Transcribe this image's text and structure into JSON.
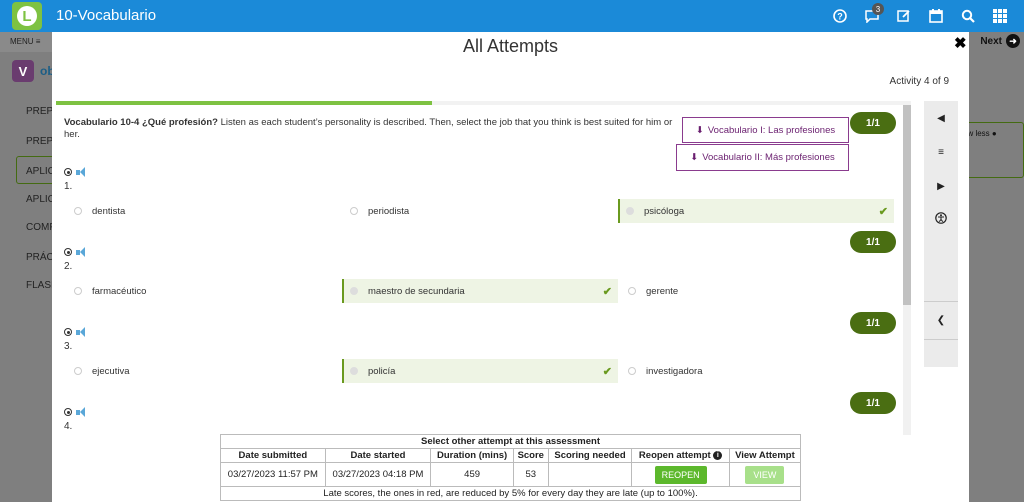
{
  "app": {
    "title": "10-Vocabulario",
    "logo_letter": "L",
    "notification_count": "3"
  },
  "top_icons": [
    "help-icon",
    "chat-icon",
    "edit-icon",
    "calendar-icon",
    "search-icon",
    "grid-icon"
  ],
  "background": {
    "menu_label": "MENU ≡",
    "logo_letter": "V",
    "logo_text": "ob",
    "nav_items": [
      "PREP",
      "PREP",
      "APLIC",
      "APLIC",
      "COMP",
      "PRÁC",
      "FLASI"
    ],
    "next_label": "Next",
    "show_less": "ow less"
  },
  "modal": {
    "title": "All Attempts",
    "activity_count": "Activity 4 of 9",
    "progress": 0.44,
    "close_label": "✖",
    "question_title": "Vocabulario 10-4 ¿Qué profesión?",
    "question_text": " Listen as each student’s personality is described. Then, select the job that you think is best suited for him or her.",
    "downloads": [
      "Vocabulario I: Las profesiones",
      "Vocabulario II: Más profesiones"
    ],
    "items": [
      {
        "num": "1.",
        "score": "1/1",
        "options": [
          "dentista",
          "periodista",
          "psicóloga"
        ],
        "selected": 2
      },
      {
        "num": "2.",
        "score": "1/1",
        "options": [
          "farmacéutico",
          "maestro de secundaria",
          "gerente"
        ],
        "selected": 1
      },
      {
        "num": "3.",
        "score": "1/1",
        "options": [
          "ejecutiva",
          "policía",
          "investigadora"
        ],
        "selected": 1
      },
      {
        "num": "4.",
        "score": "1/1"
      }
    ]
  },
  "attempts_table": {
    "caption": "Select other attempt at this assessment",
    "headers": [
      "Date submitted",
      "Date started",
      "Duration (mins)",
      "Score",
      "Scoring needed",
      "Reopen  attempt",
      "View Attempt"
    ],
    "row": {
      "date_submitted": "03/27/2023 11:57 PM",
      "date_started": "03/27/2023 04:18 PM",
      "duration": "459",
      "score": "53",
      "scoring_needed": "",
      "reopen": "REOPEN",
      "view": "VIEW"
    },
    "footnote": "Late scores, the ones in red, are reduced by 5% for every day they are late (up to 100%)."
  },
  "colors": {
    "topbar": "#1b8ad8",
    "accent_green": "#7ec242",
    "score_green": "#4a6e12",
    "download_purple": "#8a3b8e"
  }
}
